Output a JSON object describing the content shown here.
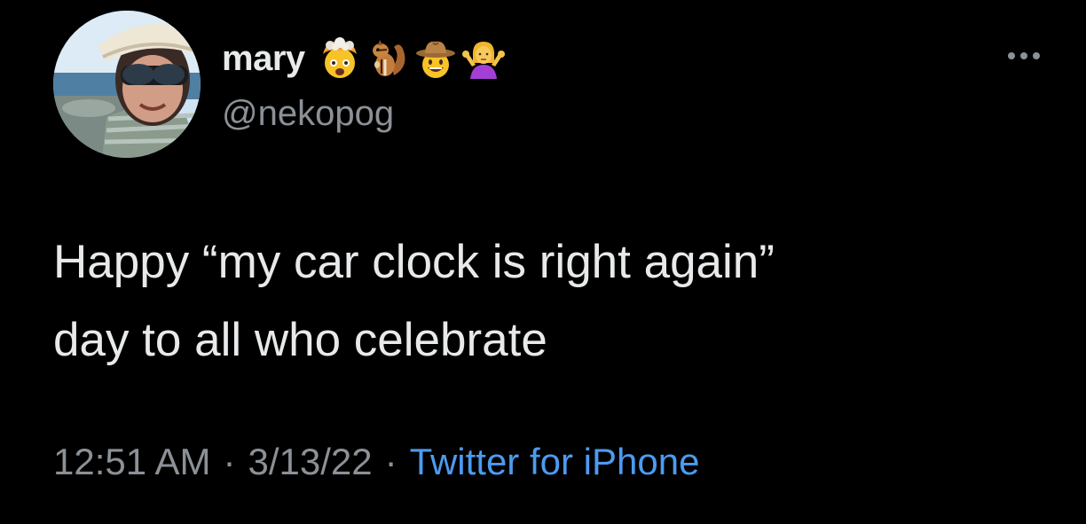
{
  "tweet": {
    "display_name": "mary",
    "handle": "@nekopog",
    "name_emojis": [
      "exploding-head-emoji",
      "chipmunk-emoji",
      "cowboy-face-emoji",
      "woman-shrugging-emoji"
    ],
    "text": "Happy “my car clock is right again”\nday to all who celebrate",
    "time": "12:51 AM",
    "date": "3/13/22",
    "separator": "·",
    "source": "Twitter for iPhone",
    "more_icon": "more-horizontal-icon"
  },
  "colors": {
    "background": "#000000",
    "primary_text": "#e7e9ea",
    "secondary_text": "#8b9196",
    "link": "#4c9bf0"
  }
}
